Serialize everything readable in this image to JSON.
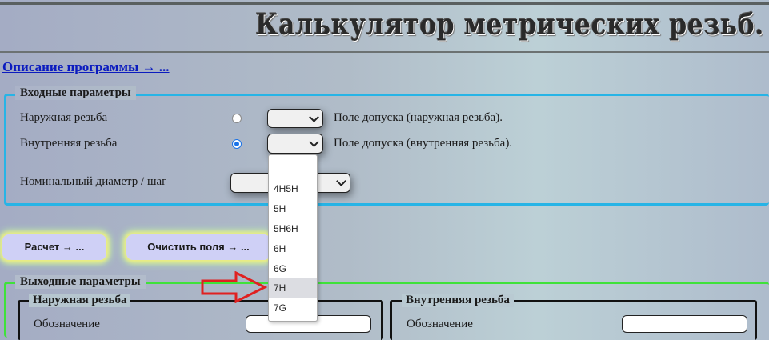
{
  "header": {
    "title": "Калькулятор метрических резьб."
  },
  "description_link": "Описание программы → ...",
  "input_params": {
    "legend": "Входные параметры",
    "external_thread": {
      "label": "Наружная резьба",
      "selected": false,
      "tolerance_label": "Поле допуска (наружная резьба)."
    },
    "internal_thread": {
      "label": "Внутренняя резьба",
      "selected": true,
      "tolerance_label": "Поле допуска (внутренняя резьба)."
    },
    "diameter_label": "Номинальный диаметр / шаг"
  },
  "buttons": {
    "calculate": "Расчет → ...",
    "clear": "Очистить поля → ..."
  },
  "output_params": {
    "legend": "Выходные параметры",
    "external": {
      "legend": "Наружная резьба",
      "first_row_label": "Обозначение"
    },
    "internal": {
      "legend": "Внутренняя резьба",
      "first_row_label": "Обозначение"
    }
  },
  "dropdown": {
    "options": [
      "",
      "4H5H",
      "5H",
      "5H6H",
      "6H",
      "6G",
      "7H",
      "7G"
    ],
    "highlighted": "7H"
  },
  "colors": {
    "input_border": "#27b4e6",
    "output_border": "#3fe23a",
    "link": "#0b1bbf",
    "arrow": "#e02020",
    "radio_accent": "#1a73e8"
  }
}
